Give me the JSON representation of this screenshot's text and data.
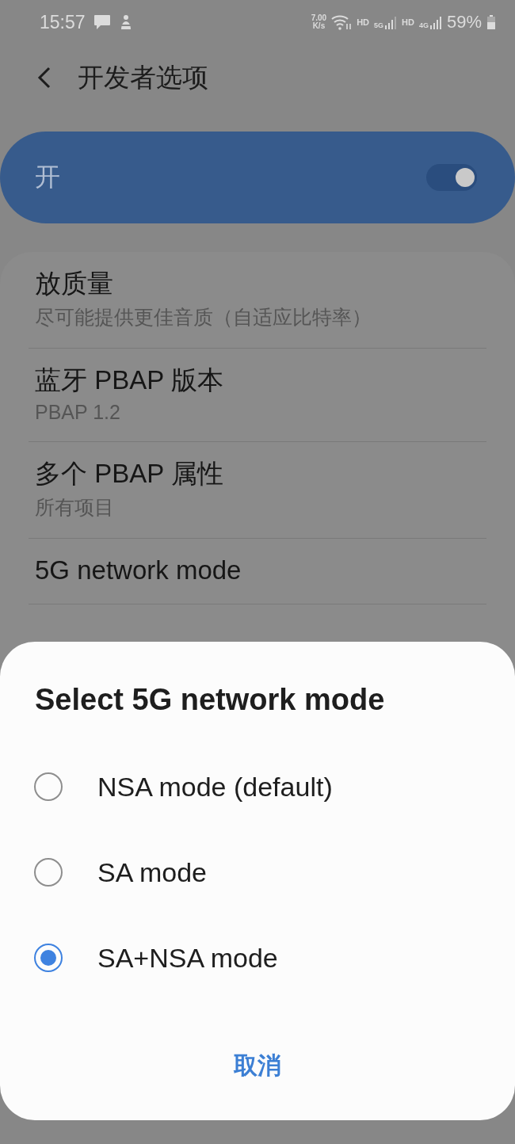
{
  "status_bar": {
    "time": "15:57",
    "speed_value": "7.00",
    "speed_unit": "K/s",
    "wifi_tag": "HD",
    "network_5g": "5G",
    "volte_tag": "HD",
    "network_4g": "4G",
    "battery": "59%"
  },
  "header": {
    "title": "开发者选项"
  },
  "master_switch": {
    "label": "开",
    "on": true
  },
  "settings": [
    {
      "title": "放质量",
      "subtitle": "尽可能提供更佳音质（自适应比特率）"
    },
    {
      "title": "蓝牙 PBAP 版本",
      "subtitle": "PBAP 1.2"
    },
    {
      "title": "多个 PBAP 属性",
      "subtitle": "所有项目"
    },
    {
      "title": "5G network mode"
    }
  ],
  "dialog": {
    "title": "Select 5G network mode",
    "options": [
      {
        "label": "NSA mode (default)",
        "selected": false
      },
      {
        "label": "SA mode",
        "selected": false
      },
      {
        "label": "SA+NSA mode",
        "selected": true
      }
    ],
    "cancel": "取消"
  }
}
